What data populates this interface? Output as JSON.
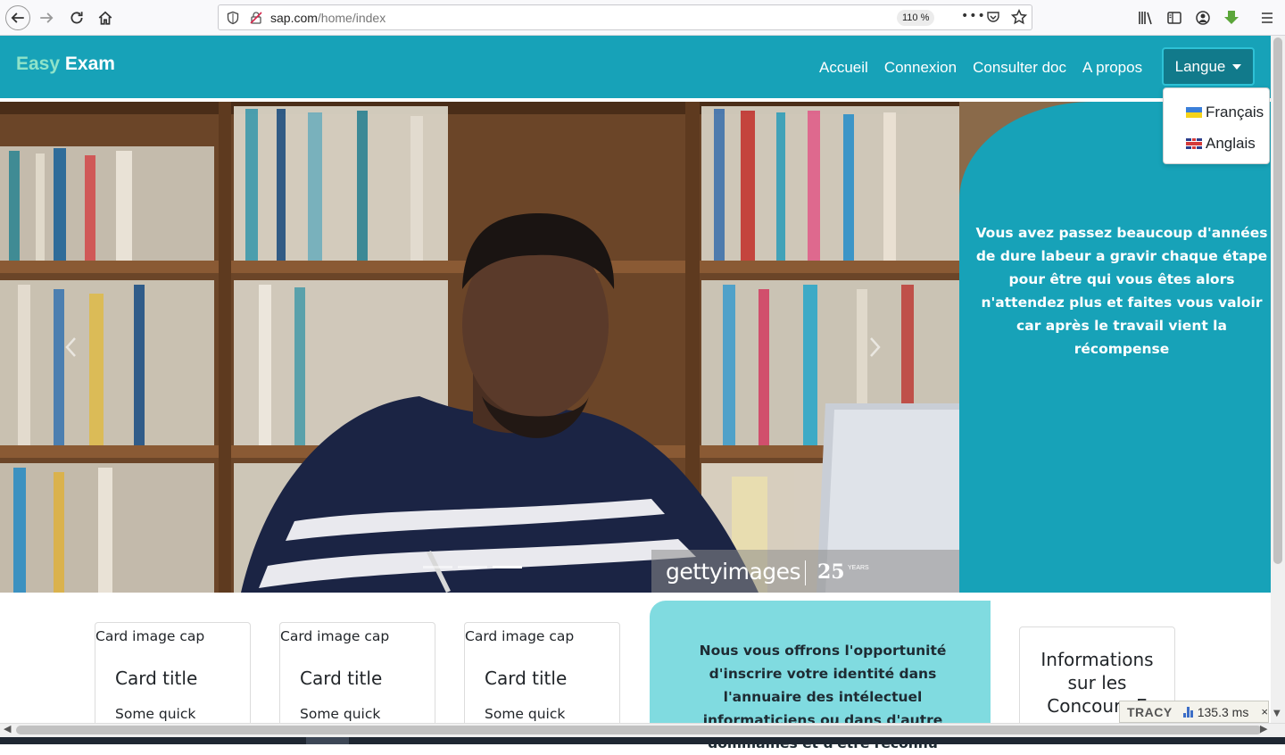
{
  "browser": {
    "url_host": "sap.com",
    "url_path": "/home/index",
    "zoom": "110 %",
    "more_label": "•••"
  },
  "navbar": {
    "brand_part1": "Easy",
    "brand_part2": "Exam",
    "links": [
      "Accueil",
      "Connexion",
      "Consulter doc",
      "A propos"
    ],
    "language_button": "Langue",
    "language_options": [
      "Français",
      "Anglais"
    ]
  },
  "hero": {
    "watermark": "gettyimages",
    "watermark_years": "25",
    "watermark_years_label": "YEARS",
    "indicator_count": 3,
    "active_indicator": 3
  },
  "side_panel": {
    "text": "Vous avez passez beaucoup d'années de dure labeur a gravir chaque étape pour être qui vous êtes alors n'attendez plus et faites vous valoir car après le travail vient la récompense"
  },
  "cards": [
    {
      "cap": "Card image cap",
      "title": "Card title",
      "text": "Some quick"
    },
    {
      "cap": "Card image cap",
      "title": "Card title",
      "text": "Some quick"
    },
    {
      "cap": "Card image cap",
      "title": "Card title",
      "text": "Some quick"
    }
  ],
  "promo": {
    "text": "Nous vous offrons l'opportunité d'inscrire votre identité dans l'annuaire des intélectuel informaticiens ou dans d'autre dommaines et d'être reconnu"
  },
  "info_card": {
    "text": "Informations sur les Concours E"
  },
  "tracy": {
    "label": "TRACY",
    "time": "135.3 ms",
    "close": "×"
  },
  "colors": {
    "primary_teal": "#17a2b8",
    "dark_teal": "#117a8b",
    "light_teal": "#80dbe0",
    "brand_green": "#8fe3c9"
  }
}
